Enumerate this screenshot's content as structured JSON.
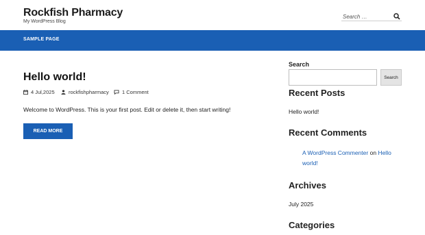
{
  "site": {
    "title": "Rockfish Pharmacy",
    "description": "My WordPress Blog"
  },
  "header_search": {
    "placeholder": "Search …"
  },
  "nav": {
    "items": [
      {
        "label": "SAMPLE PAGE"
      }
    ]
  },
  "post": {
    "title": "Hello world!",
    "date": "4 Jul,2025",
    "author": "rockfishpharmacy",
    "comments": "1 Comment",
    "excerpt": "Welcome to WordPress. This is your first post. Edit or delete it, then start writing!",
    "read_more": "READ MORE"
  },
  "sidebar": {
    "search_label": "Search",
    "search_button": "Search",
    "recent_posts": {
      "title": "Recent Posts",
      "items": [
        {
          "label": "Hello world!"
        }
      ]
    },
    "recent_comments": {
      "title": "Recent Comments",
      "author": "A WordPress Commenter",
      "on": "on",
      "post_line1": "Hello",
      "post_line2": "world!"
    },
    "archives": {
      "title": "Archives",
      "items": [
        {
          "label": "July 2025"
        }
      ]
    },
    "categories": {
      "title": "Categories"
    }
  },
  "colors": {
    "accent": "#1a5fb4"
  },
  "icons": [
    "search-icon",
    "calendar-icon",
    "user-icon",
    "comment-icon"
  ]
}
